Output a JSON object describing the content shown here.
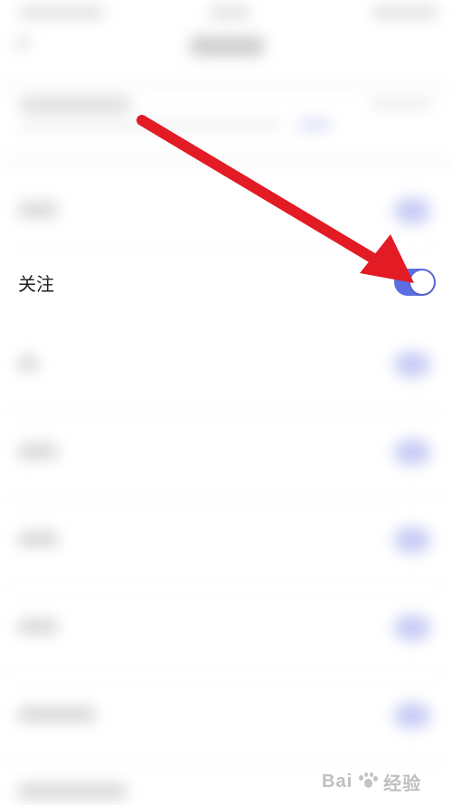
{
  "focus_row": {
    "label": "关注",
    "toggle_on": true
  },
  "colors": {
    "toggle_active": "#5b6fe0",
    "arrow": "#e21b24",
    "background": "#ffffff",
    "text": "#222222"
  },
  "watermark": {
    "brand": "Bai",
    "suffix": "经验"
  },
  "icons": {
    "arrow": "arrow-annotation-icon",
    "watermark_logo": "baidu-paw-icon"
  }
}
